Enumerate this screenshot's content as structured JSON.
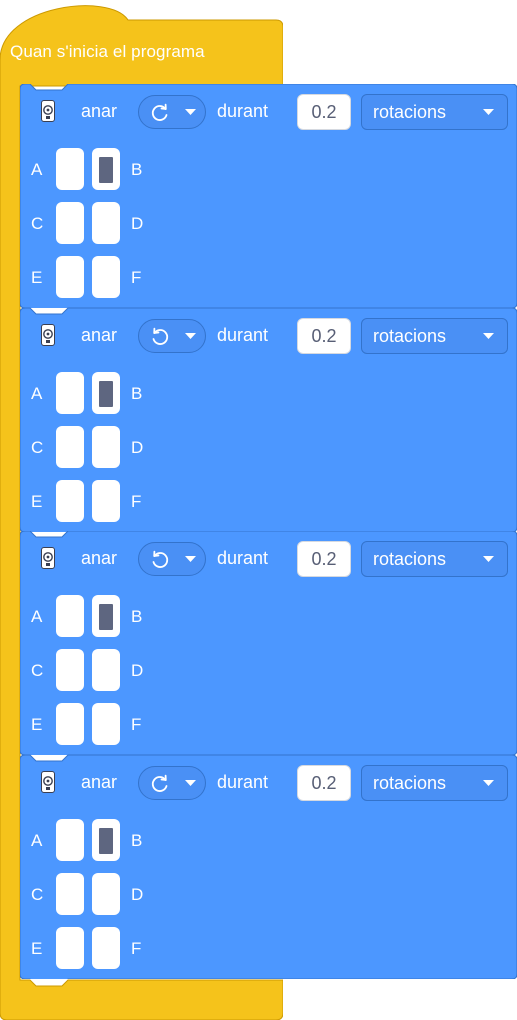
{
  "hat": {
    "label": "Quan s'inicia el programa",
    "color": "#F5C31B"
  },
  "colors": {
    "block": "#4C97FF",
    "block_border": "#3373CC",
    "port_selected": "#5E6680"
  },
  "blocks": [
    {
      "verb": "anar",
      "direction": "clockwise",
      "direction_icon": "rotate-clockwise-icon",
      "during": "durant",
      "value": "0.2",
      "unit": "rotacions",
      "ports": {
        "A": "A",
        "B": "B",
        "C": "C",
        "D": "D",
        "E": "E",
        "F": "F"
      },
      "selected_port": "B"
    },
    {
      "verb": "anar",
      "direction": "counterclockwise",
      "direction_icon": "rotate-counterclockwise-icon",
      "during": "durant",
      "value": "0.2",
      "unit": "rotacions",
      "ports": {
        "A": "A",
        "B": "B",
        "C": "C",
        "D": "D",
        "E": "E",
        "F": "F"
      },
      "selected_port": "B"
    },
    {
      "verb": "anar",
      "direction": "counterclockwise",
      "direction_icon": "rotate-counterclockwise-icon",
      "during": "durant",
      "value": "0.2",
      "unit": "rotacions",
      "ports": {
        "A": "A",
        "B": "B",
        "C": "C",
        "D": "D",
        "E": "E",
        "F": "F"
      },
      "selected_port": "B"
    },
    {
      "verb": "anar",
      "direction": "clockwise",
      "direction_icon": "rotate-clockwise-icon",
      "during": "durant",
      "value": "0.2",
      "unit": "rotacions",
      "ports": {
        "A": "A",
        "B": "B",
        "C": "C",
        "D": "D",
        "E": "E",
        "F": "F"
      },
      "selected_port": "B"
    }
  ]
}
